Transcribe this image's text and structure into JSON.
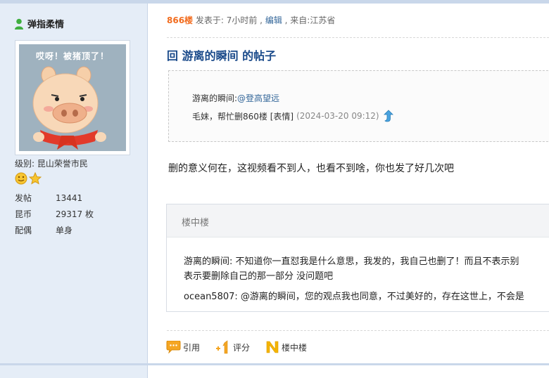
{
  "sidebar": {
    "username": "弹指柔情",
    "avatar_text": "哎呀！被猪顶了！",
    "level": "级别: 昆山荣誉市民",
    "stats": [
      {
        "label": "发帖",
        "value": "13441"
      },
      {
        "label": "昆币",
        "value": "29317 枚"
      },
      {
        "label": "配偶",
        "value": "单身"
      }
    ]
  },
  "post": {
    "floor": "866楼",
    "posted_label": " 发表于: 7小时前 , ",
    "edit_label": "编辑",
    "location": " , 来自:江苏省",
    "title": "回 游离的瞬间 的帖子",
    "quote": {
      "author_prefix": "游离的瞬间:",
      "mention": "@登高望远",
      "text": "毛妹，帮忙删860楼 [表情]",
      "date": "(2024-03-20 09:12)"
    },
    "body": "删的意义何在，这视频看不到人，也看不到啥，你也发了好几次吧"
  },
  "lzl": {
    "title": "楼中楼",
    "comment1_line1": "游离的瞬间: 不知道你一直怼我是什么意思，我发的，我自己也删了！而且不表示别",
    "comment1_line2": "表示要删除自己的那一部分 没问题吧",
    "comment2": "ocean5807: @游离的瞬间，您的观点我也同意，不过美好的，存在这世上，不会是"
  },
  "actions": {
    "quote_label": "引用",
    "rate_label": "评分",
    "lzl_label": "楼中楼"
  },
  "colors": {
    "sidebar_bg": "#e5edf7",
    "floor": "#f26c1e",
    "title": "#1a4a8a",
    "link": "#336699"
  }
}
